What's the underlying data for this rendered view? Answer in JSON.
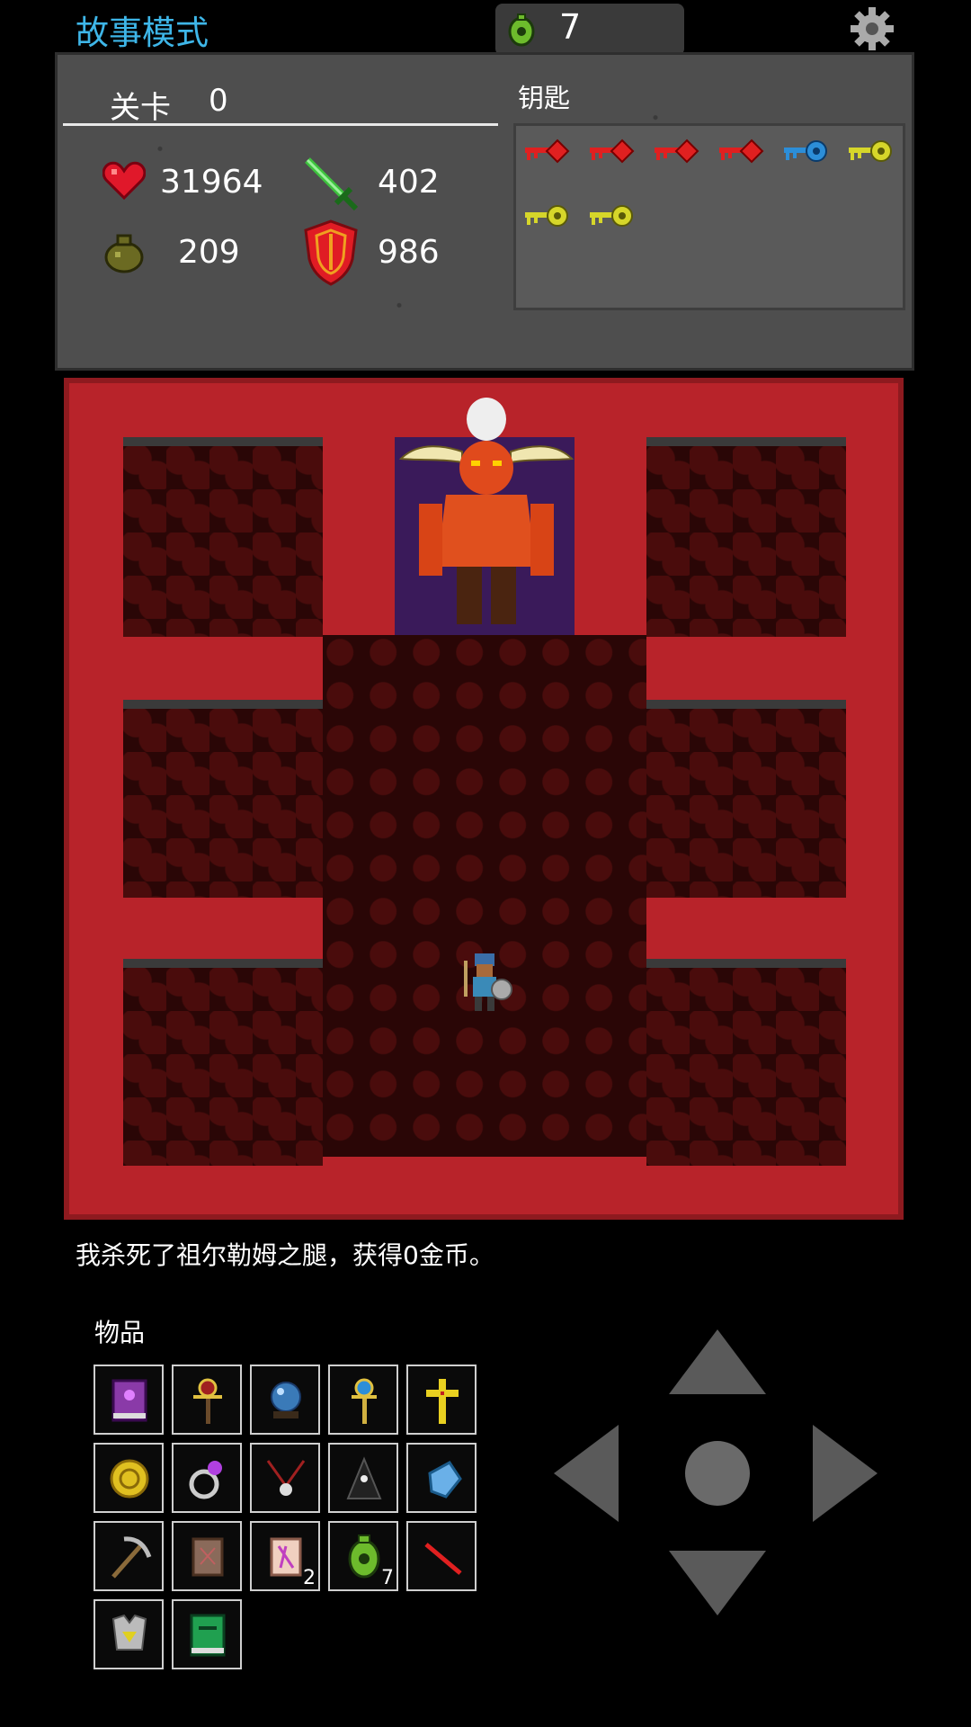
{
  "header": {
    "mode_title": "故事模式",
    "gem_count": "7"
  },
  "stats": {
    "level_label": "关卡",
    "level_value": "0",
    "hp": "31964",
    "attack": "402",
    "gold": "209",
    "defense": "986"
  },
  "keys": {
    "label": "钥匙",
    "items": [
      "red-key",
      "red-key",
      "red-key",
      "red-key",
      "blue-key",
      "yellow-key",
      "yellow-key",
      "yellow-key"
    ]
  },
  "colors": {
    "red_key": "#e02020",
    "blue_key": "#2c8ed8",
    "yellow_key": "#d6d62a",
    "mode_title": "#3eb6e8",
    "lava_wall": "#b8232a"
  },
  "log": {
    "message": "我杀死了祖尔勒姆之腿，获得0金币。"
  },
  "inventory": {
    "label": "物品",
    "items": [
      {
        "icon": "spellbook-icon",
        "count": ""
      },
      {
        "icon": "staff-icon",
        "count": ""
      },
      {
        "icon": "crystal-ball-icon",
        "count": ""
      },
      {
        "icon": "golden-scepter-icon",
        "count": ""
      },
      {
        "icon": "holy-cross-icon",
        "count": ""
      },
      {
        "icon": "gold-coin-icon",
        "count": ""
      },
      {
        "icon": "magic-ring-icon",
        "count": ""
      },
      {
        "icon": "amulet-icon",
        "count": ""
      },
      {
        "icon": "hooded-cloak-icon",
        "count": ""
      },
      {
        "icon": "glove-icon",
        "count": ""
      },
      {
        "icon": "pickaxe-icon",
        "count": ""
      },
      {
        "icon": "scroll-icon",
        "count": ""
      },
      {
        "icon": "pink-scroll-icon",
        "count": "2"
      },
      {
        "icon": "green-gem-icon",
        "count": "7"
      },
      {
        "icon": "red-wand-icon",
        "count": ""
      },
      {
        "icon": "armor-icon",
        "count": ""
      },
      {
        "icon": "green-book-icon",
        "count": ""
      }
    ]
  }
}
